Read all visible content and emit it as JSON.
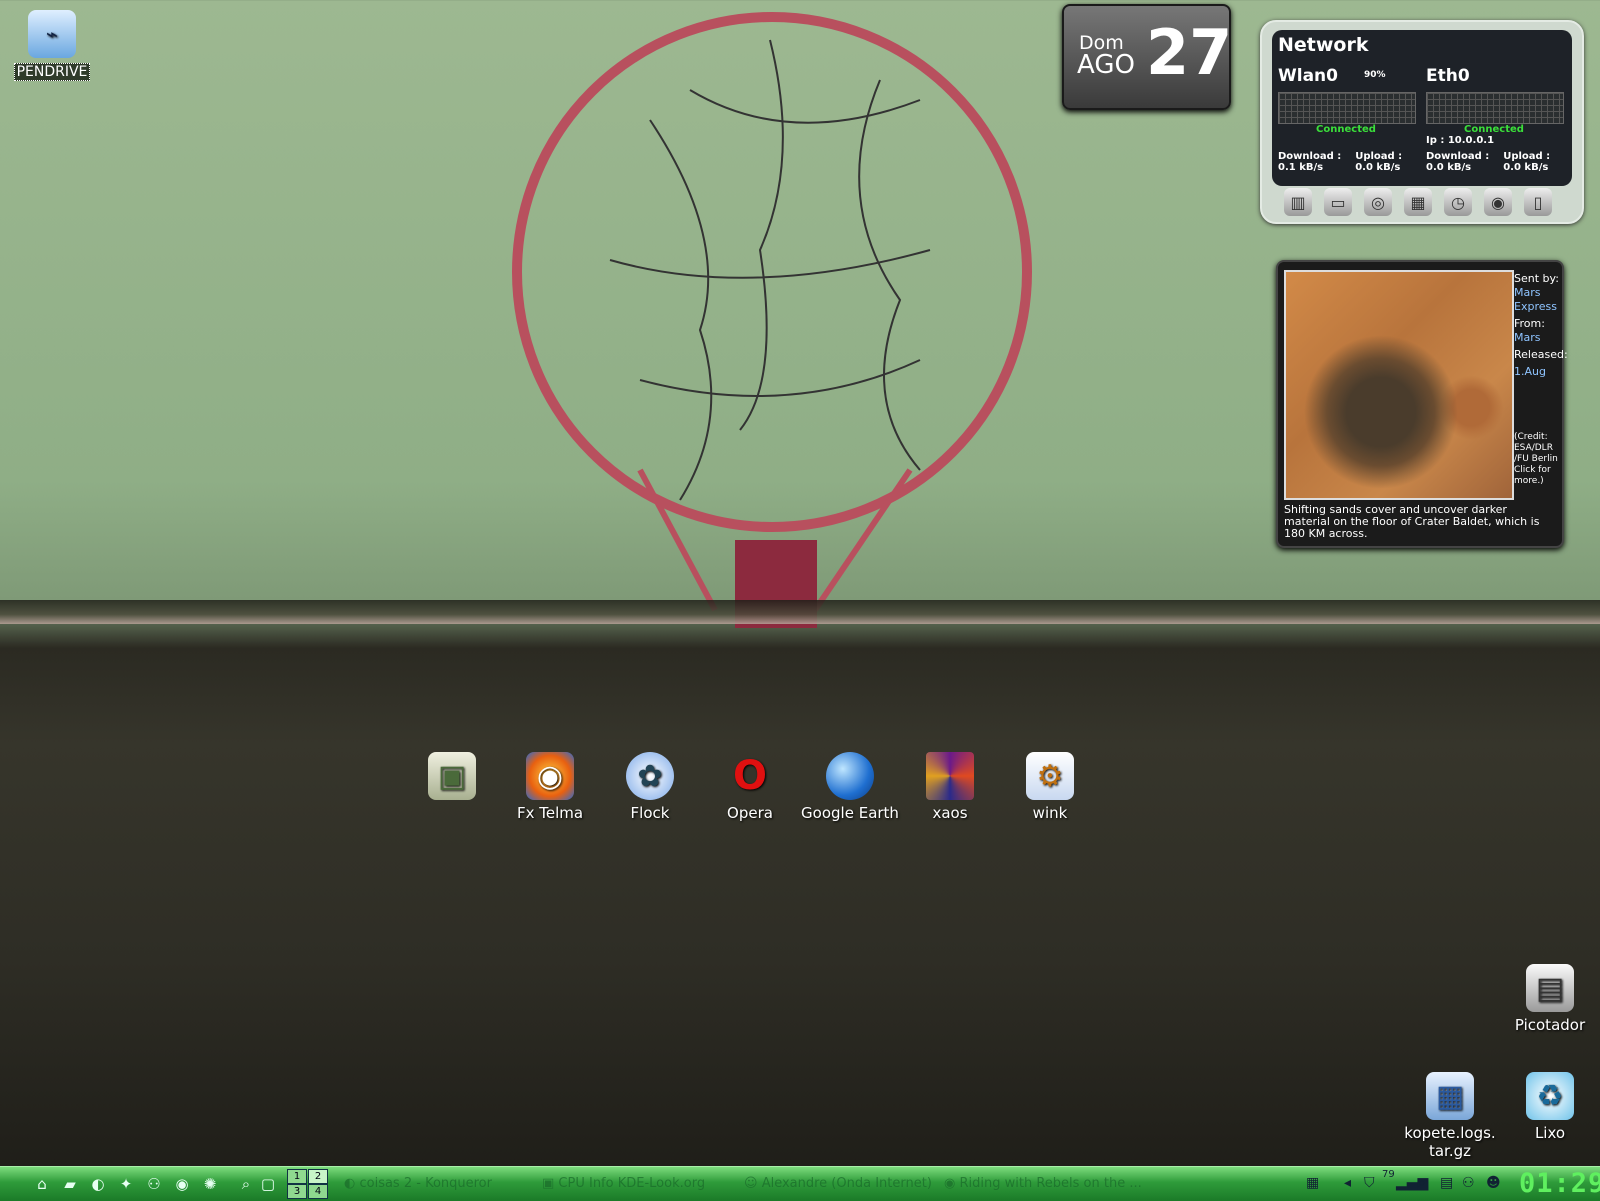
{
  "desktop": {
    "pendrive": {
      "label": "PENDRIVE",
      "icon": "usb-drive-icon"
    },
    "launchers": [
      {
        "label": "",
        "icon": "monitor-icon"
      },
      {
        "label": "Fx Telma",
        "icon": "firefox-icon"
      },
      {
        "label": "Flock",
        "icon": "flock-icon"
      },
      {
        "label": "Opera",
        "icon": "opera-icon"
      },
      {
        "label": "Google Earth",
        "icon": "google-earth-icon"
      },
      {
        "label": "xaos",
        "icon": "fractal-icon"
      },
      {
        "label": "wink",
        "icon": "wink-icon"
      }
    ],
    "picotador": {
      "label": "Picotador",
      "icon": "shredder-icon"
    },
    "kopete": {
      "label": "kopete.logs.\ntar.gz",
      "line1": "kopete.logs.",
      "line2": "tar.gz",
      "icon": "archive-icon"
    },
    "lixo": {
      "label": "Lixo",
      "icon": "trash-icon"
    }
  },
  "date_widget": {
    "dow": "Dom",
    "month": "AGO",
    "day": "27"
  },
  "network_widget": {
    "title": "Network",
    "interfaces": [
      {
        "name": "Wlan0",
        "signal": "90%",
        "status": "Connected",
        "ip": "",
        "download_label": "Download :",
        "download": "0.1 kB/s",
        "upload_label": "Upload :",
        "upload": "0.0 kB/s"
      },
      {
        "name": "Eth0",
        "signal": "",
        "status": "Connected",
        "ip": "Ip : 10.0.0.1",
        "download_label": "Download :",
        "download": "0.0 kB/s",
        "upload_label": "Upload :",
        "upload": "0.0 kB/s"
      }
    ],
    "tools": [
      "memory-icon",
      "disk-icon",
      "speaker-icon",
      "network-icon",
      "clock-icon",
      "cd-icon",
      "monitor-icon"
    ]
  },
  "apod_widget": {
    "sent_by_label": "Sent by:",
    "sent_by": "Mars Express",
    "from_label": "From:",
    "from": "Mars",
    "released_label": "Released:",
    "released": "1.Aug",
    "credit": "(Credit: ESA/DLR /FU Berlin Click for more.)",
    "caption": "Shifting sands cover and uncover darker material on the floor of Crater Baldet, which is 180 KM across."
  },
  "taskbar": {
    "quick_icons": [
      "home-icon",
      "folder-icon",
      "konqueror-icon",
      "star-icon",
      "network-icon",
      "firefox-icon",
      "settings-icon"
    ],
    "pager": [
      "1",
      "2",
      "3",
      "4"
    ],
    "tasks": [
      {
        "title": "coisas 2 - Konqueror",
        "icon": "konqueror-icon"
      },
      {
        "title": "CPU Info KDE-Look.org",
        "icon": "kde-icon"
      },
      {
        "title": "Alexandre (Onda Internet)",
        "icon": "kopete-icon"
      },
      {
        "title": "Riding with Rebels on the ...",
        "icon": "firefox-icon"
      }
    ],
    "tray_value": "79",
    "clock": "01:29",
    "colors": {
      "taskbar": "#2e9b3a",
      "clock": "#5ff05f"
    }
  }
}
